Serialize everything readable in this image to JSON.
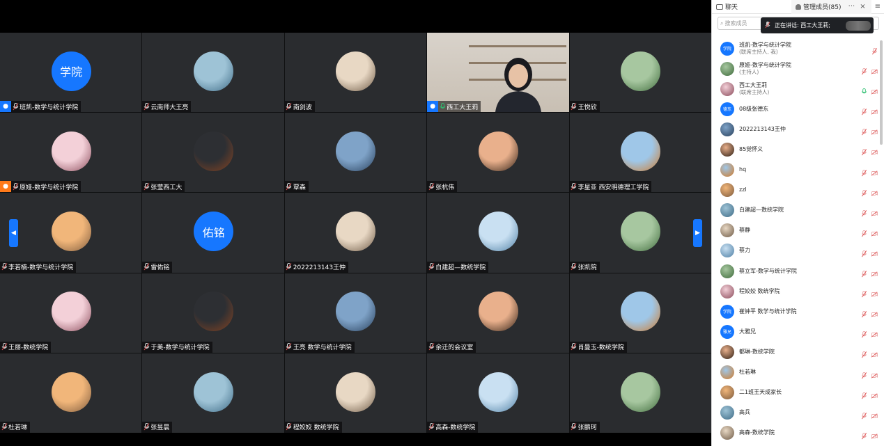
{
  "panel": {
    "chat_tab": "聊天",
    "members_tab": "管理成员(85)",
    "more": "···",
    "close": "×",
    "menu": "≡",
    "search_placeholder": "搜索成员",
    "speaking_label": "正在讲话: 西工大王莉;"
  },
  "colors": {
    "accent": "#1677ff",
    "host_orange": "#ff7a1a",
    "speaking_green": "#2fbf71",
    "muted_red": "#e05050"
  },
  "tiles": [
    {
      "name": "班凯-数学与统计学院",
      "avatar_text": "学院",
      "host": "blue"
    },
    {
      "name": "云南师大王亮"
    },
    {
      "name": "南剑波"
    },
    {
      "name": "西工大王莉",
      "host": "blue",
      "active": true
    },
    {
      "name": "王悦欣"
    },
    {
      "name": "原娅-数学与统计学院",
      "host": "orange"
    },
    {
      "name": "张莹西工大"
    },
    {
      "name": "覃森"
    },
    {
      "name": "张杭伟"
    },
    {
      "name": "李星亚 西安明德理工学院"
    },
    {
      "name": "李若楠-数学与统计学院"
    },
    {
      "name": "雷佑铭",
      "avatar_text": "佑铭"
    },
    {
      "name": "2022213143王仲"
    },
    {
      "name": "白建超—数统学院"
    },
    {
      "name": "张凯院"
    },
    {
      "name": "王丽-数统学院"
    },
    {
      "name": "于美-数学与统计学院"
    },
    {
      "name": "王亮 数学与统计学院"
    },
    {
      "name": "余迁的会议室"
    },
    {
      "name": "肖曼玉-数统学院"
    },
    {
      "name": "杜若琳"
    },
    {
      "name": "张昱晨"
    },
    {
      "name": "程姣姣 数统学院"
    },
    {
      "name": "高森-数统学院"
    },
    {
      "name": "张鹏珂"
    }
  ],
  "members": [
    {
      "name": "班凯-数学与统计学院",
      "sub": "(联席主持人, 我)",
      "avatar_text": "学院"
    },
    {
      "name": "原娅-数学与统计学院",
      "sub": "(主持人)"
    },
    {
      "name": "西工大王莉",
      "sub": "(联席主持人)",
      "speaking": true
    },
    {
      "name": "08级张德东",
      "avatar_text": "德东"
    },
    {
      "name": "2022213143王仲"
    },
    {
      "name": "85觉怀义"
    },
    {
      "name": "hq"
    },
    {
      "name": "zzl"
    },
    {
      "name": "白建超—数统学院"
    },
    {
      "name": "蔡静"
    },
    {
      "name": "蔡力"
    },
    {
      "name": "蔡立军-数学与统计学院"
    },
    {
      "name": "程姣姣 数统学院"
    },
    {
      "name": "崔钟平 数学与统计学院",
      "avatar_text": "学院"
    },
    {
      "name": "大雅兄",
      "avatar_text": "雅兄"
    },
    {
      "name": "都琳-数统学院"
    },
    {
      "name": "杜若琳"
    },
    {
      "name": "二1班王天成家长"
    },
    {
      "name": "高兵"
    },
    {
      "name": "高森-数统学院"
    }
  ]
}
